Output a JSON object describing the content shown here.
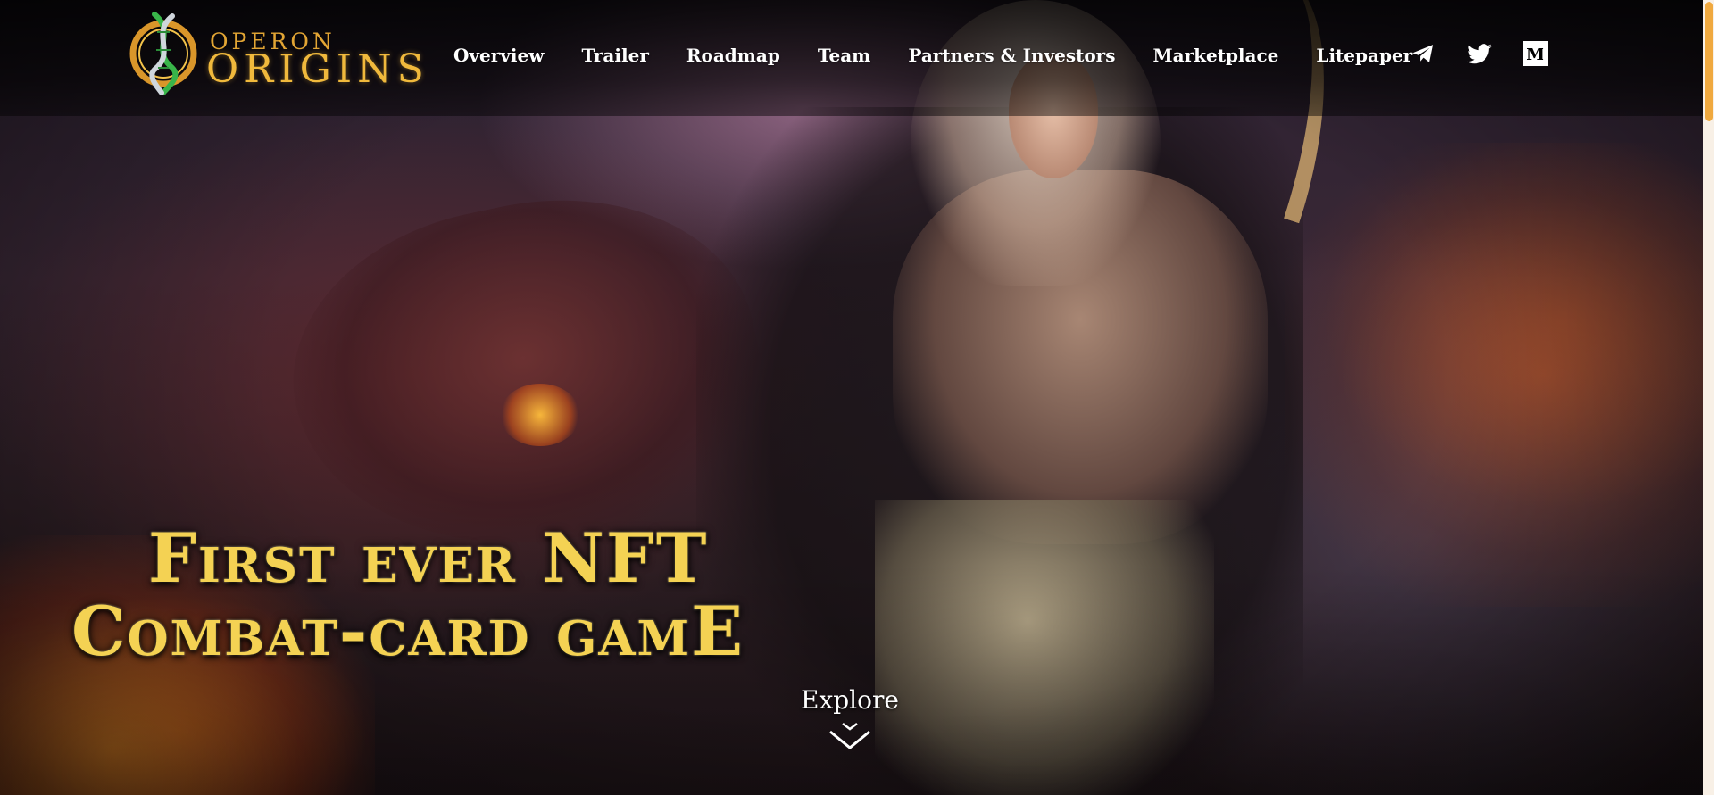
{
  "brand": {
    "logo_top": "OPERON",
    "logo_main": "ORIGINS"
  },
  "nav": {
    "items": [
      {
        "label": "Overview"
      },
      {
        "label": "Trailer"
      },
      {
        "label": "Roadmap"
      },
      {
        "label": "Team"
      },
      {
        "label": "Partners & Investors"
      },
      {
        "label": "Marketplace"
      },
      {
        "label": "Litepaper"
      }
    ]
  },
  "social": {
    "icons": [
      "telegram-icon",
      "twitter-icon",
      "medium-icon"
    ],
    "medium_glyph": "M"
  },
  "hero": {
    "headline_line1": "First ever NFT",
    "headline_line2": "Combat-card gamE",
    "explore_label": "Explore"
  },
  "colors": {
    "gold": "#f4d253",
    "logo_gold": "#f0b93c",
    "accent_orange": "#f0a93f",
    "nav_text": "#ffffff"
  }
}
